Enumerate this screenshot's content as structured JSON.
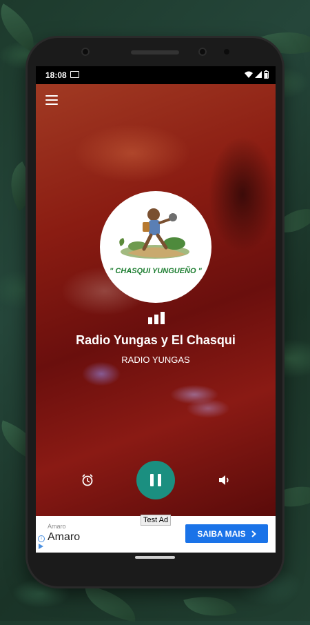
{
  "status_bar": {
    "time": "18:08"
  },
  "station": {
    "logo_text": "\" CHASQUI YUNGUEÑO \"",
    "name": "Radio Yungas y El Chasqui",
    "subtitle": "RADIO YUNGAS"
  },
  "ad": {
    "label": "Test Ad",
    "advertiser_small": "Amaro",
    "advertiser_big": "Amaro",
    "cta_label": "SAIBA MAIS"
  },
  "colors": {
    "play_button": "#1b8f80",
    "ad_cta": "#1a73e8",
    "logo_text": "#1a7c2e"
  },
  "icons": [
    "menu-icon",
    "alarm-icon",
    "pause-icon",
    "volume-icon",
    "equalizer-icon",
    "wifi-icon",
    "signal-icon",
    "battery-icon",
    "cast-icon",
    "chevron-right-icon",
    "ad-info-icon",
    "ad-play-icon"
  ]
}
